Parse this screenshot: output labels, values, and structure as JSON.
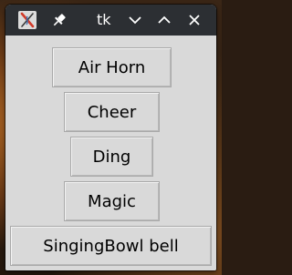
{
  "window": {
    "title": "tk",
    "icons": {
      "app": "tk-app-icon",
      "pin": "pin-icon",
      "minimize": "chevron-down-icon",
      "maximize": "chevron-up-icon",
      "close": "close-icon"
    }
  },
  "buttons": [
    {
      "label": "Air Horn"
    },
    {
      "label": "Cheer"
    },
    {
      "label": "Ding"
    },
    {
      "label": "Magic"
    },
    {
      "label": "SingingBowl bell"
    }
  ],
  "colors": {
    "titlebar": "#2c2f33",
    "window_bg": "#d9d9d9",
    "button_bg": "#d9d9d9",
    "button_border": "#a9a9a9",
    "text": "#000000"
  }
}
